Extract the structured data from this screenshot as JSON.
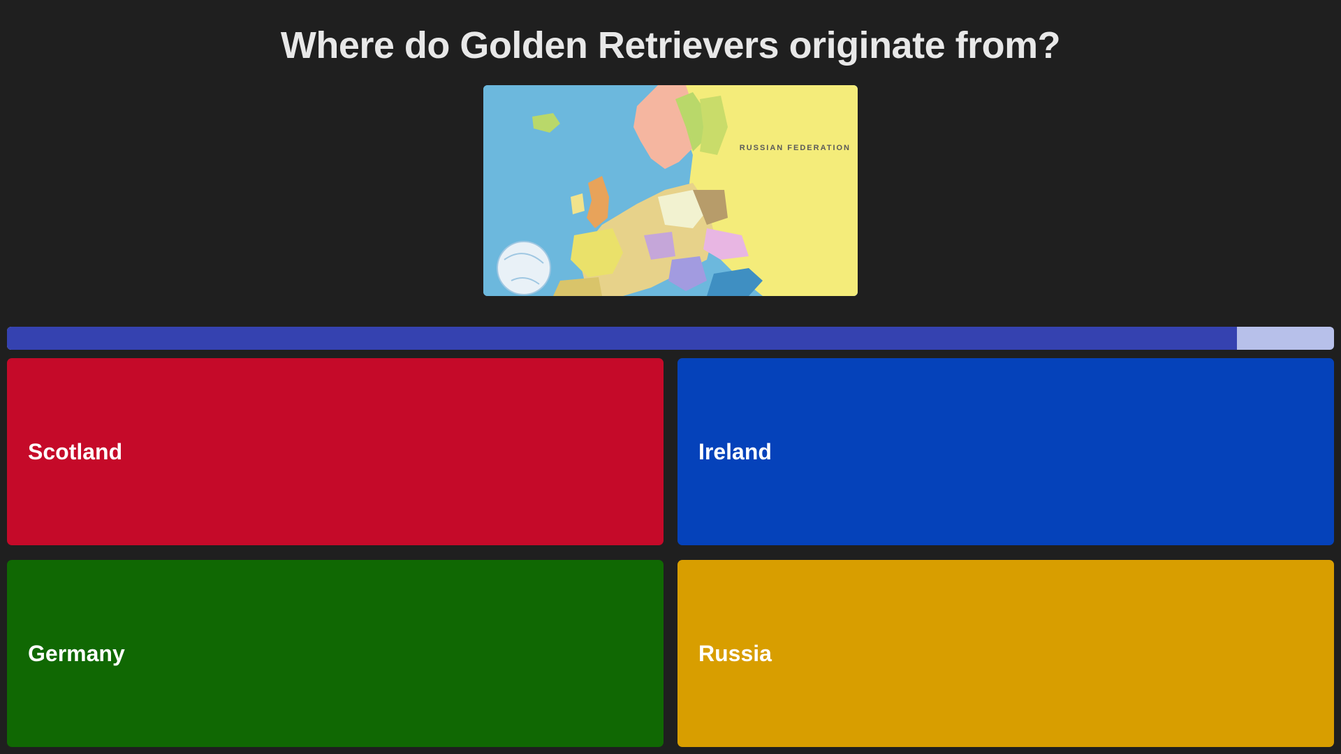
{
  "question": "Where do Golden Retrievers originate from?",
  "map": {
    "label": "RUSSIAN FEDERATION",
    "icon": "europe-map-image"
  },
  "timer": {
    "progress_fraction": 0.927,
    "fill_color": "#3542b0",
    "track_color": "#b7c0ea"
  },
  "answers": [
    {
      "label": "Scotland",
      "color": "#c50a29"
    },
    {
      "label": "Ireland",
      "color": "#0542ba"
    },
    {
      "label": "Germany",
      "color": "#106803"
    },
    {
      "label": "Russia",
      "color": "#d89e00"
    }
  ]
}
